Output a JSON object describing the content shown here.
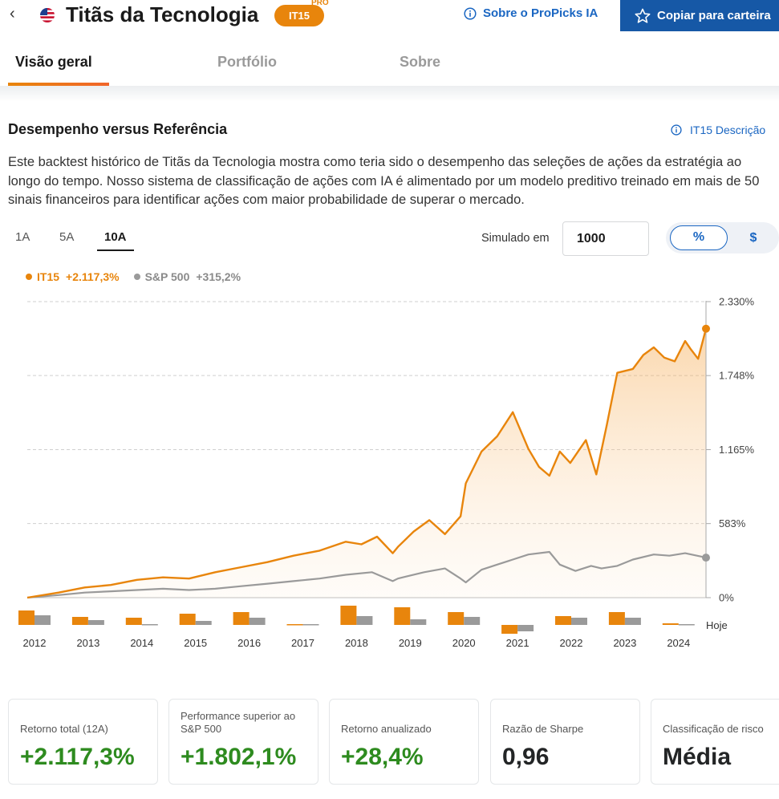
{
  "header": {
    "back_icon": "chevron-left-icon",
    "flag_icon": "us-flag-icon",
    "title": "Titãs da Tecnologia",
    "badge": "IT15",
    "pro_label": "PRO",
    "about_link": "Sobre o ProPicks IA",
    "copy_button": "Copiar para carteira"
  },
  "tabs": [
    {
      "label": "Visão geral",
      "active": true
    },
    {
      "label": "Portfólio",
      "active": false
    },
    {
      "label": "Sobre",
      "active": false
    }
  ],
  "section": {
    "title": "Desempenho versus Referência",
    "description_link": "IT15 Descrição",
    "description": "Este backtest histórico de Titãs da Tecnologia mostra como teria sido o desempenho das seleções de ações da estratégia ao longo do tempo. Nosso sistema de classificação de ações com IA é alimentado por um modelo preditivo treinado em mais de 50 sinais financeiros para identificar ações com maior probabilidade de superar o mercado."
  },
  "controls": {
    "periods": [
      "1A",
      "5A",
      "10A"
    ],
    "active_period": "10A",
    "simulated_label": "Simulado em",
    "simulated_value": "1000",
    "toggle_percent": "%",
    "toggle_dollar": "$"
  },
  "legend": {
    "it15_name": "IT15",
    "it15_value": "+2.117,3%",
    "sp_name": "S&P 500",
    "sp_value": "+315,2%"
  },
  "colors": {
    "it15": "#e8850c",
    "sp500": "#9a9a9a",
    "link": "#1a66c2",
    "positive": "#2e8b1f",
    "button": "#1658a6"
  },
  "chart_data": {
    "type": "line",
    "y_tick_labels": [
      "2.330%",
      "1.748%",
      "1.165%",
      "583%",
      "0%"
    ],
    "y_ticks": [
      2330,
      1748,
      1165,
      583,
      0
    ],
    "ylim": [
      0,
      2330
    ],
    "grid": true,
    "x_labels": [
      "2012",
      "2013",
      "2014",
      "2015",
      "2016",
      "2017",
      "2018",
      "2019",
      "2020",
      "2021",
      "2022",
      "2023",
      "2024"
    ],
    "today_label": "Hoje",
    "series": [
      {
        "name": "IT15",
        "x": [
          2011.9,
          2012.5,
          2013.0,
          2013.5,
          2014.0,
          2014.5,
          2015.0,
          2015.5,
          2016.0,
          2016.5,
          2017.0,
          2017.5,
          2018.0,
          2018.3,
          2018.6,
          2018.9,
          2019.0,
          2019.3,
          2019.6,
          2019.9,
          2020.2,
          2020.3,
          2020.6,
          2020.9,
          2021.2,
          2021.5,
          2021.7,
          2021.9,
          2022.1,
          2022.3,
          2022.6,
          2022.8,
          2023.0,
          2023.2,
          2023.5,
          2023.7,
          2023.9,
          2024.1,
          2024.3,
          2024.5,
          2024.6,
          2024.75,
          2024.9
        ],
        "values": [
          0,
          40,
          80,
          100,
          140,
          160,
          150,
          200,
          240,
          280,
          330,
          370,
          440,
          420,
          480,
          350,
          400,
          520,
          610,
          500,
          640,
          900,
          1150,
          1270,
          1460,
          1170,
          1030,
          960,
          1150,
          1060,
          1240,
          970,
          1360,
          1770,
          1800,
          1910,
          1970,
          1890,
          1860,
          2020,
          1960,
          1880,
          2117
        ]
      },
      {
        "name": "S&P 500",
        "x": [
          2011.9,
          2012.5,
          2013.0,
          2013.5,
          2014.0,
          2014.5,
          2015.0,
          2015.5,
          2016.0,
          2016.5,
          2017.0,
          2017.5,
          2018.0,
          2018.5,
          2018.9,
          2019.0,
          2019.5,
          2019.9,
          2020.2,
          2020.3,
          2020.6,
          2020.9,
          2021.2,
          2021.5,
          2021.9,
          2022.1,
          2022.4,
          2022.7,
          2022.9,
          2023.2,
          2023.5,
          2023.9,
          2024.2,
          2024.5,
          2024.9
        ],
        "values": [
          0,
          20,
          40,
          50,
          60,
          70,
          60,
          70,
          90,
          110,
          130,
          150,
          180,
          200,
          130,
          150,
          200,
          230,
          150,
          120,
          220,
          260,
          300,
          340,
          360,
          260,
          210,
          250,
          230,
          250,
          300,
          340,
          330,
          350,
          315
        ]
      }
    ],
    "annual_returns": {
      "years": [
        2012,
        2013,
        2014,
        2015,
        2016,
        2017,
        2018,
        2019,
        2020,
        2021,
        2022,
        2023,
        2024
      ],
      "it15": [
        18,
        10,
        9,
        14,
        16,
        1,
        24,
        22,
        16,
        -11,
        11,
        16,
        2
      ],
      "sp500": [
        12,
        6,
        1,
        5,
        9,
        1,
        11,
        7,
        10,
        -8,
        9,
        9,
        1
      ]
    }
  },
  "stats": [
    {
      "label": "Retorno total (12A)",
      "value": "+2.117,3%",
      "tone": "pos"
    },
    {
      "label": "Performance superior ao S&P 500",
      "value": "+1.802,1%",
      "tone": "pos"
    },
    {
      "label": "Retorno anualizado",
      "value": "+28,4%",
      "tone": "pos"
    },
    {
      "label": "Razão de Sharpe",
      "value": "0,96",
      "tone": "neu"
    },
    {
      "label": "Classificação de risco",
      "value": "Média",
      "tone": "neu"
    }
  ]
}
